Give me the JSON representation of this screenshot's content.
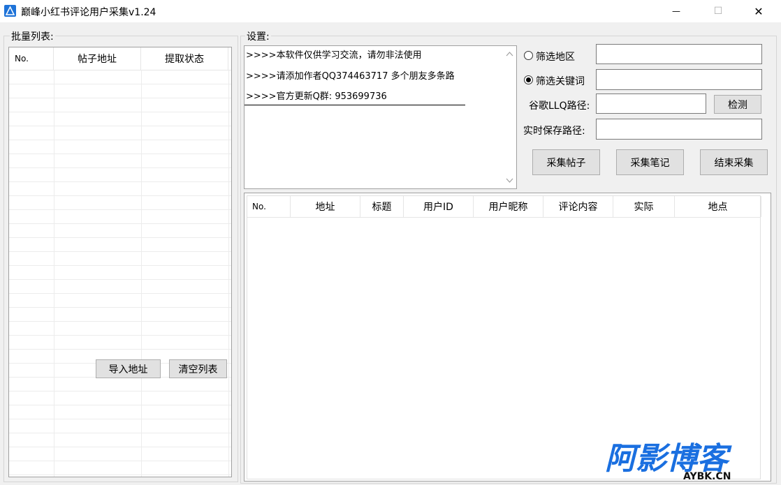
{
  "window": {
    "title": "巅峰小红书评论用户采集v1.24",
    "minimize": "—",
    "maximize": "☐",
    "close": "✕"
  },
  "batch": {
    "group_label": "批量列表:",
    "columns": [
      "No.",
      "帖子地址",
      "提取状态"
    ],
    "import_button": "导入地址",
    "clear_button": "清空列表"
  },
  "settings": {
    "group_label": "设置:",
    "log_lines": [
      ">>>>本软件仅供学习交流，请勿非法使用",
      ">>>>请添加作者QQ374463717 多个朋友多条路",
      ">>>>官方更新Q群: 953699736"
    ],
    "filter_region_label": "筛选地区",
    "filter_keyword_label": "筛选关键词",
    "filter_region_value": "",
    "filter_keyword_value": "",
    "filter_selected": "keyword",
    "chrome_path_label": "谷歌LLQ路径:",
    "chrome_path_value": "",
    "check_button": "检测",
    "save_path_label": "实时保存路径:",
    "save_path_value": "",
    "collect_posts_button": "采集帖子",
    "collect_notes_button": "采集笔记",
    "stop_button": "结束采集"
  },
  "results": {
    "columns": [
      "No.",
      "地址",
      "标题",
      "用户ID",
      "用户昵称",
      "评论内容",
      "实际",
      "地点"
    ]
  },
  "watermark": {
    "main": "阿影博客",
    "sub": "AYBK.CN",
    "color": "#1a6fe0"
  }
}
